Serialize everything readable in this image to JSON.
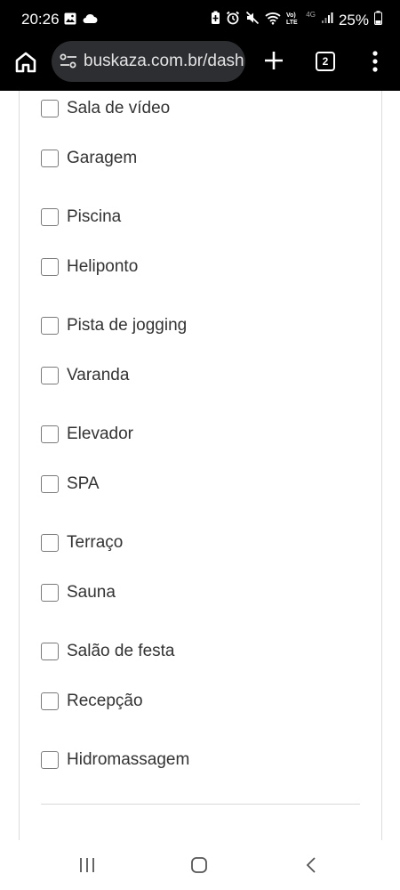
{
  "status_bar": {
    "time": "20:26",
    "battery_percent": "25%",
    "network": "4G",
    "icons": [
      "image-icon",
      "cloud-icon",
      "battery-saver-icon",
      "alarm-icon",
      "mute-icon",
      "wifi-icon",
      "volte-icon",
      "signal-icon",
      "battery-icon"
    ]
  },
  "browser": {
    "url": "buskaza.com.br/dash",
    "tab_count": "2"
  },
  "amenities": {
    "options": [
      {
        "label": "Sala de vídeo",
        "checked": false
      },
      {
        "label": "Garagem",
        "checked": false
      },
      {
        "label": "Piscina",
        "checked": false
      },
      {
        "label": "Heliponto",
        "checked": false
      },
      {
        "label": "Pista de jogging",
        "checked": false
      },
      {
        "label": "Varanda",
        "checked": false
      },
      {
        "label": "Elevador",
        "checked": false
      },
      {
        "label": "SPA",
        "checked": false
      },
      {
        "label": "Terraço",
        "checked": false
      },
      {
        "label": "Sauna",
        "checked": false
      },
      {
        "label": "Salão de festa",
        "checked": false
      },
      {
        "label": "Recepção",
        "checked": false
      },
      {
        "label": "Hidromassagem",
        "checked": false
      }
    ]
  },
  "colors": {
    "browser_bar": "#000000",
    "url_pill": "#2d2e31",
    "checkbox_border": "#757575",
    "label_text": "#333333"
  }
}
